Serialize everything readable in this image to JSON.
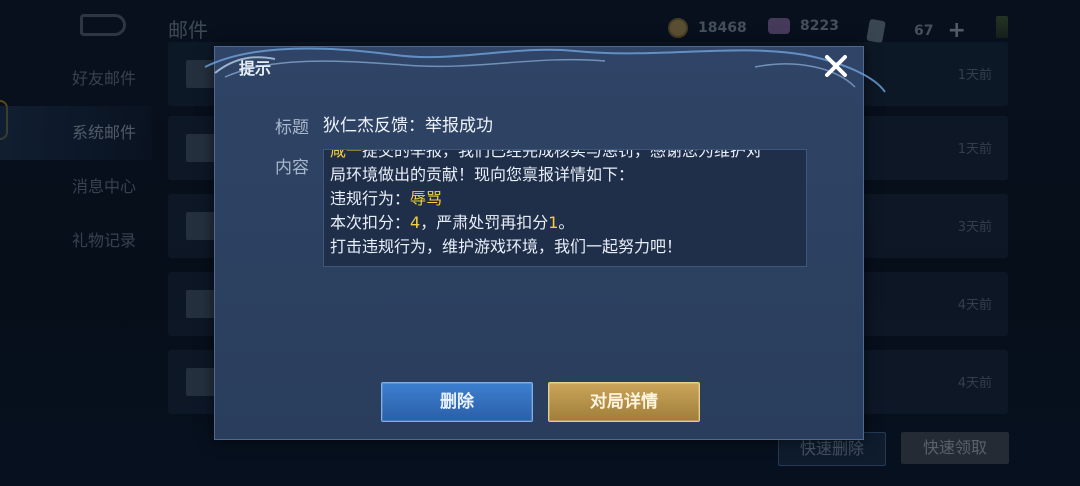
{
  "header": {
    "title": "邮件",
    "gold": "18468",
    "diamond": "8223",
    "card_count": "67"
  },
  "sidebar": {
    "items": [
      {
        "label": "好友邮件"
      },
      {
        "label": "系统邮件"
      },
      {
        "label": "消息中心"
      },
      {
        "label": "礼物记录"
      }
    ]
  },
  "mail_list": {
    "rows": [
      {
        "time": "1天前"
      },
      {
        "time": "1天前"
      },
      {
        "time": "3天前"
      },
      {
        "time": "4天前"
      },
      {
        "time": "4天前"
      }
    ]
  },
  "bottom": {
    "quick_delete": "快速删除",
    "quick_claim": "快速领取"
  },
  "dialog": {
    "title": "提示",
    "subject_label": "标题",
    "subject_value": "狄仁杰反馈：举报成功",
    "content_label": "内容",
    "content": {
      "line1_name": "咸一",
      "line1_rest": "提交的举报，我们已经完成核实与惩罚，感谢您为维护对",
      "line2": "局环境做出的贡献！现向您禀报详情如下：",
      "line3_label": "违规行为：",
      "line3_value": "辱骂",
      "line4_prefix": "本次扣分：",
      "line4_score": "4",
      "line4_mid": "，严肃处罚再扣分",
      "line4_extra": "1",
      "line4_end": "。",
      "line5": "打击违规行为，维护游戏环境，我们一起努力吧！"
    },
    "delete_label": "删除",
    "detail_label": "对局详情"
  },
  "colors": {
    "accent_blue": "#3c7fd0",
    "accent_gold": "#caa55a",
    "highlight": "#f2cd3e"
  }
}
